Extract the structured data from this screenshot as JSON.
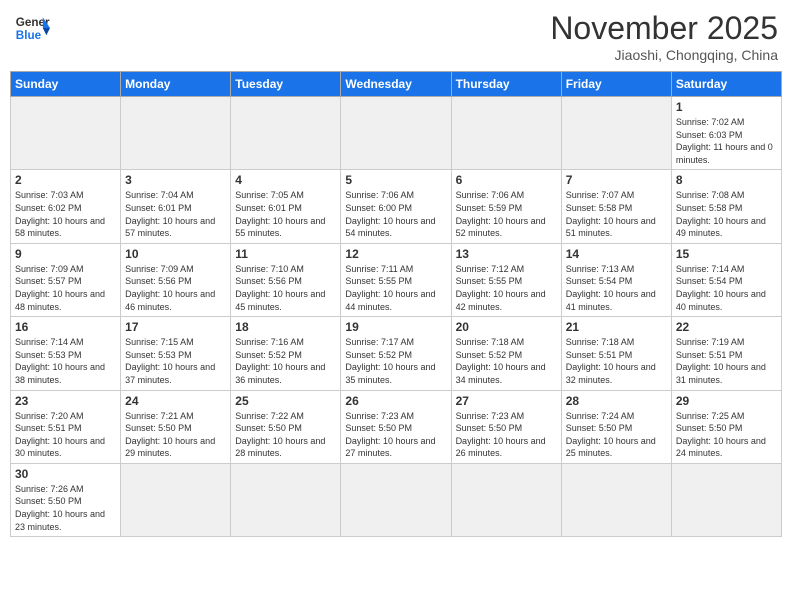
{
  "logo": {
    "text_general": "General",
    "text_blue": "Blue"
  },
  "header": {
    "month_year": "November 2025",
    "location": "Jiaoshi, Chongqing, China"
  },
  "days_of_week": [
    "Sunday",
    "Monday",
    "Tuesday",
    "Wednesday",
    "Thursday",
    "Friday",
    "Saturday"
  ],
  "weeks": [
    [
      {
        "day": "",
        "info": ""
      },
      {
        "day": "",
        "info": ""
      },
      {
        "day": "",
        "info": ""
      },
      {
        "day": "",
        "info": ""
      },
      {
        "day": "",
        "info": ""
      },
      {
        "day": "",
        "info": ""
      },
      {
        "day": "1",
        "info": "Sunrise: 7:02 AM\nSunset: 6:03 PM\nDaylight: 11 hours and 0 minutes."
      }
    ],
    [
      {
        "day": "2",
        "info": "Sunrise: 7:03 AM\nSunset: 6:02 PM\nDaylight: 10 hours and 58 minutes."
      },
      {
        "day": "3",
        "info": "Sunrise: 7:04 AM\nSunset: 6:01 PM\nDaylight: 10 hours and 57 minutes."
      },
      {
        "day": "4",
        "info": "Sunrise: 7:05 AM\nSunset: 6:01 PM\nDaylight: 10 hours and 55 minutes."
      },
      {
        "day": "5",
        "info": "Sunrise: 7:06 AM\nSunset: 6:00 PM\nDaylight: 10 hours and 54 minutes."
      },
      {
        "day": "6",
        "info": "Sunrise: 7:06 AM\nSunset: 5:59 PM\nDaylight: 10 hours and 52 minutes."
      },
      {
        "day": "7",
        "info": "Sunrise: 7:07 AM\nSunset: 5:58 PM\nDaylight: 10 hours and 51 minutes."
      },
      {
        "day": "8",
        "info": "Sunrise: 7:08 AM\nSunset: 5:58 PM\nDaylight: 10 hours and 49 minutes."
      }
    ],
    [
      {
        "day": "9",
        "info": "Sunrise: 7:09 AM\nSunset: 5:57 PM\nDaylight: 10 hours and 48 minutes."
      },
      {
        "day": "10",
        "info": "Sunrise: 7:09 AM\nSunset: 5:56 PM\nDaylight: 10 hours and 46 minutes."
      },
      {
        "day": "11",
        "info": "Sunrise: 7:10 AM\nSunset: 5:56 PM\nDaylight: 10 hours and 45 minutes."
      },
      {
        "day": "12",
        "info": "Sunrise: 7:11 AM\nSunset: 5:55 PM\nDaylight: 10 hours and 44 minutes."
      },
      {
        "day": "13",
        "info": "Sunrise: 7:12 AM\nSunset: 5:55 PM\nDaylight: 10 hours and 42 minutes."
      },
      {
        "day": "14",
        "info": "Sunrise: 7:13 AM\nSunset: 5:54 PM\nDaylight: 10 hours and 41 minutes."
      },
      {
        "day": "15",
        "info": "Sunrise: 7:14 AM\nSunset: 5:54 PM\nDaylight: 10 hours and 40 minutes."
      }
    ],
    [
      {
        "day": "16",
        "info": "Sunrise: 7:14 AM\nSunset: 5:53 PM\nDaylight: 10 hours and 38 minutes."
      },
      {
        "day": "17",
        "info": "Sunrise: 7:15 AM\nSunset: 5:53 PM\nDaylight: 10 hours and 37 minutes."
      },
      {
        "day": "18",
        "info": "Sunrise: 7:16 AM\nSunset: 5:52 PM\nDaylight: 10 hours and 36 minutes."
      },
      {
        "day": "19",
        "info": "Sunrise: 7:17 AM\nSunset: 5:52 PM\nDaylight: 10 hours and 35 minutes."
      },
      {
        "day": "20",
        "info": "Sunrise: 7:18 AM\nSunset: 5:52 PM\nDaylight: 10 hours and 34 minutes."
      },
      {
        "day": "21",
        "info": "Sunrise: 7:18 AM\nSunset: 5:51 PM\nDaylight: 10 hours and 32 minutes."
      },
      {
        "day": "22",
        "info": "Sunrise: 7:19 AM\nSunset: 5:51 PM\nDaylight: 10 hours and 31 minutes."
      }
    ],
    [
      {
        "day": "23",
        "info": "Sunrise: 7:20 AM\nSunset: 5:51 PM\nDaylight: 10 hours and 30 minutes."
      },
      {
        "day": "24",
        "info": "Sunrise: 7:21 AM\nSunset: 5:50 PM\nDaylight: 10 hours and 29 minutes."
      },
      {
        "day": "25",
        "info": "Sunrise: 7:22 AM\nSunset: 5:50 PM\nDaylight: 10 hours and 28 minutes."
      },
      {
        "day": "26",
        "info": "Sunrise: 7:23 AM\nSunset: 5:50 PM\nDaylight: 10 hours and 27 minutes."
      },
      {
        "day": "27",
        "info": "Sunrise: 7:23 AM\nSunset: 5:50 PM\nDaylight: 10 hours and 26 minutes."
      },
      {
        "day": "28",
        "info": "Sunrise: 7:24 AM\nSunset: 5:50 PM\nDaylight: 10 hours and 25 minutes."
      },
      {
        "day": "29",
        "info": "Sunrise: 7:25 AM\nSunset: 5:50 PM\nDaylight: 10 hours and 24 minutes."
      }
    ],
    [
      {
        "day": "30",
        "info": "Sunrise: 7:26 AM\nSunset: 5:50 PM\nDaylight: 10 hours and 23 minutes."
      },
      {
        "day": "",
        "info": ""
      },
      {
        "day": "",
        "info": ""
      },
      {
        "day": "",
        "info": ""
      },
      {
        "day": "",
        "info": ""
      },
      {
        "day": "",
        "info": ""
      },
      {
        "day": "",
        "info": ""
      }
    ]
  ]
}
